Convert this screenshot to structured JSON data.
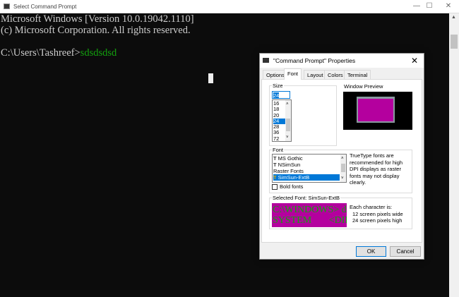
{
  "window": {
    "title": "Select Command Prompt",
    "controls": [
      "—",
      "☐",
      "✕"
    ]
  },
  "console": {
    "lines": [
      "Microsoft Windows [Version 10.0.19042.1110]",
      "(c) Microsoft Corporation. All rights reserved.",
      ""
    ],
    "prompt": "C:\\Users\\Tashreef>",
    "input": "sdsdsdsd"
  },
  "dialog": {
    "title": "\"Command Prompt\" Properties",
    "close": "✕",
    "tabs": [
      {
        "label": "Options"
      },
      {
        "label": "Font",
        "selected": true
      },
      {
        "label": "Layout"
      },
      {
        "label": "Colors"
      },
      {
        "label": "Terminal"
      }
    ],
    "size": {
      "label": "Size",
      "value": "24",
      "options": [
        "16",
        "18",
        "20",
        "24",
        "28",
        "36",
        "72"
      ],
      "selected": "24"
    },
    "preview": {
      "label": "Window Preview",
      "color": "#b4009e"
    },
    "font": {
      "label": "Font",
      "items": [
        {
          "label": "MS Gothic",
          "icon": "truetype-icon"
        },
        {
          "label": "NSimSun",
          "icon": "truetype-icon"
        },
        {
          "label": "Raster Fonts"
        },
        {
          "label": "SimSun-ExtB",
          "icon": "truetype-icon",
          "selected": true
        }
      ],
      "note": "TrueType fonts are recommended for high DPI displays as raster fonts may not display clearly.",
      "bold_label": "Bold fonts",
      "bold_checked": false
    },
    "selected_font": {
      "label": "Selected Font: SimSun-ExtB",
      "sample_lines": [
        "C:\\WINDOWS> dir",
        "SYSTEM       <DIR>"
      ],
      "char_info": "Each character is:",
      "width_info": "12 screen pixels wide",
      "height_info": "24 screen pixels high",
      "bg": "#b4009e",
      "fg": "#13a10e"
    },
    "ok": "OK",
    "cancel": "Cancel"
  }
}
